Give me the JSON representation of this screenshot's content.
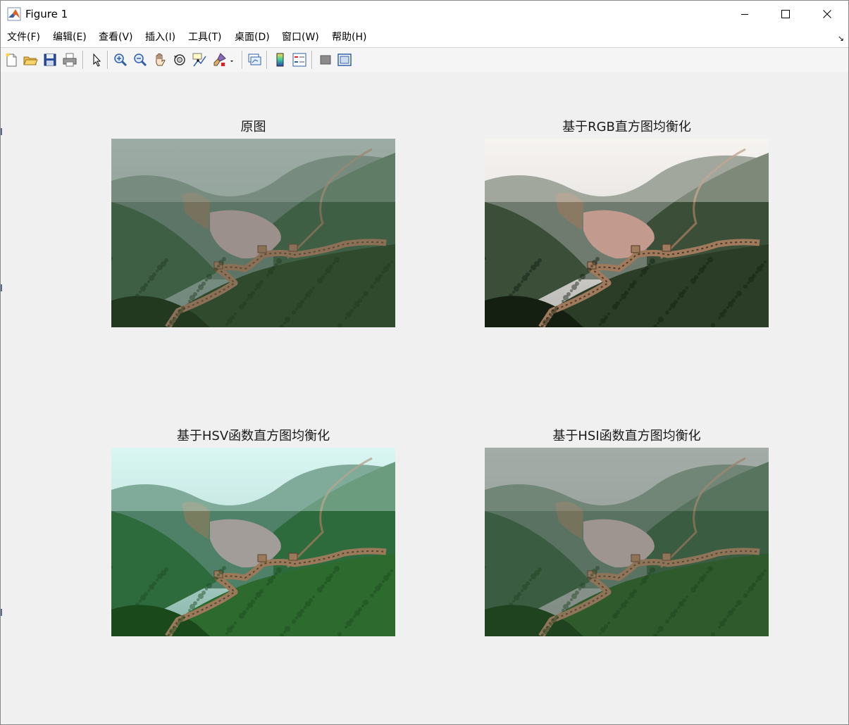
{
  "window": {
    "title": "Figure 1",
    "icon": "matlab-icon",
    "controls": [
      "minimize-icon",
      "maximize-icon",
      "close-icon"
    ]
  },
  "menubar": {
    "items": [
      {
        "label": "文件(F)"
      },
      {
        "label": "编辑(E)"
      },
      {
        "label": "查看(V)"
      },
      {
        "label": "插入(I)"
      },
      {
        "label": "工具(T)"
      },
      {
        "label": "桌面(D)"
      },
      {
        "label": "窗口(W)"
      },
      {
        "label": "帮助(H)"
      }
    ],
    "corner_glyph": "↘"
  },
  "toolbar": {
    "buttons": [
      "new-figure-icon",
      "open-file-icon",
      "save-icon",
      "print-icon",
      "edit-plot-arrow-icon",
      "zoom-in-icon",
      "zoom-out-icon",
      "pan-hand-icon",
      "rotate-3d-icon",
      "data-cursor-icon",
      "brush-icon",
      "brush-dropdown-icon",
      "link-plot-icon",
      "colorbar-icon",
      "legend-icon",
      "hide-plot-tools-icon",
      "show-plot-tools-icon"
    ]
  },
  "panels": [
    {
      "title": "原图",
      "variant": "original"
    },
    {
      "title": "基于RGB直方图均衡化",
      "variant": "rgb"
    },
    {
      "title": "基于HSV函数直方图均衡化",
      "variant": "hsv"
    },
    {
      "title": "基于HSI函数直方图均衡化",
      "variant": "hsi"
    }
  ],
  "colors": {
    "figure_bg": "#f0f0f0",
    "title_bar_bg": "#ffffff",
    "matlab_orange": "#e0602a",
    "matlab_blue": "#3a5fa0"
  }
}
